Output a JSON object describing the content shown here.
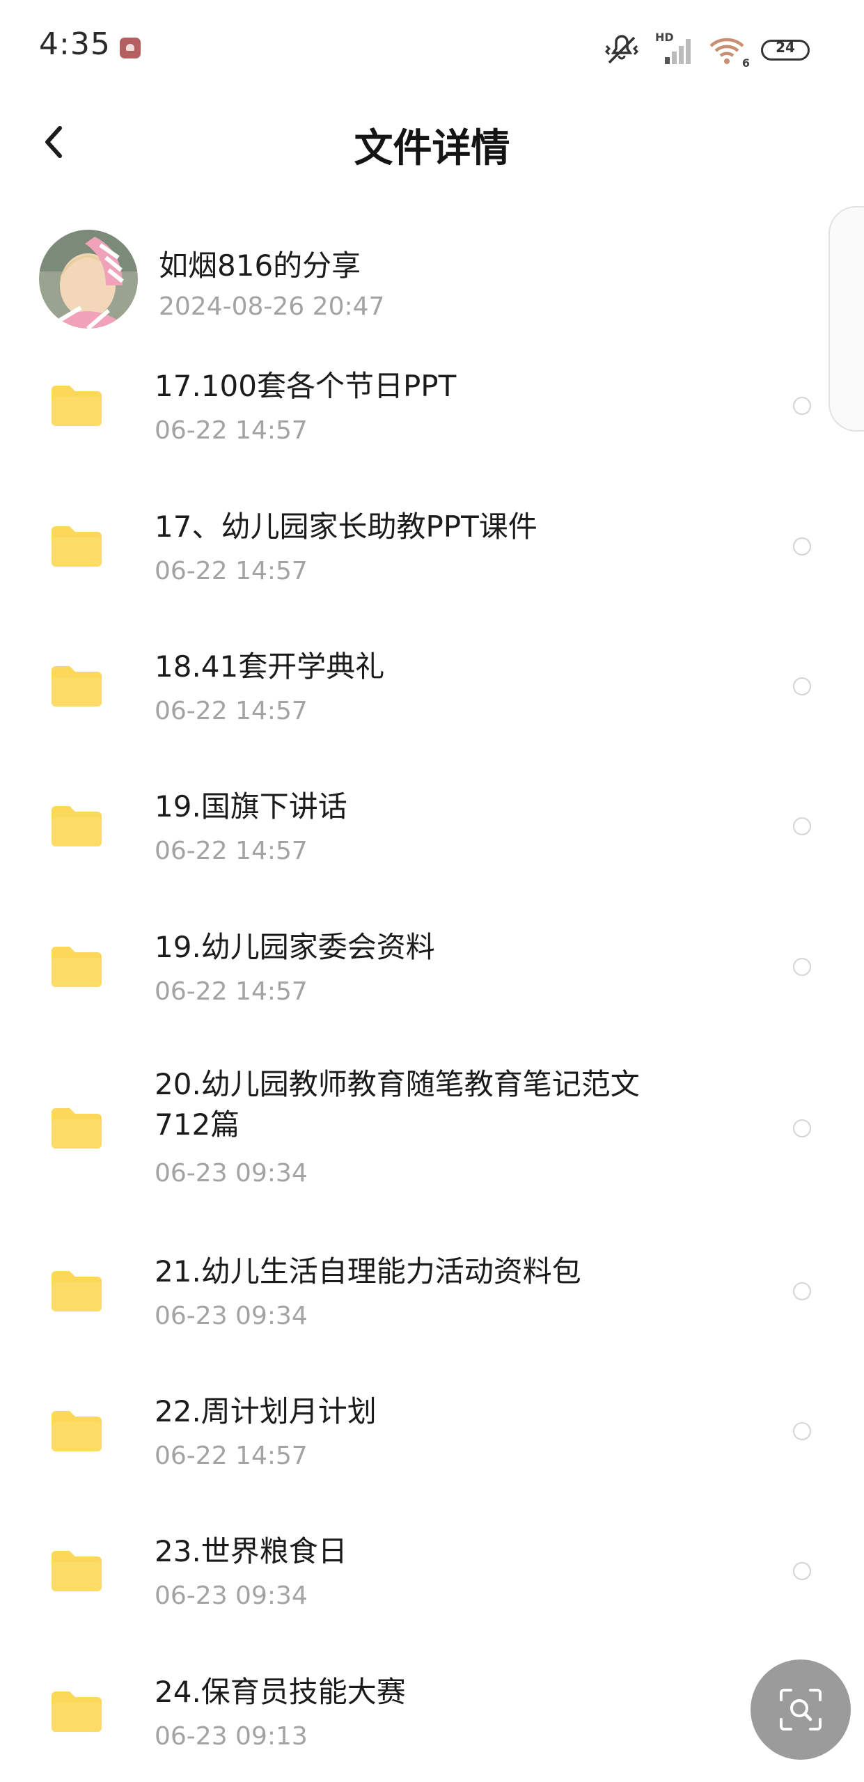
{
  "status_bar": {
    "time": "4:35",
    "network_label": "HD",
    "wifi_badge": "6",
    "battery": "24",
    "icons": [
      "app-notification-icon",
      "vibrate-off-icon",
      "cell-signal-icon",
      "wifi-icon",
      "battery-icon"
    ]
  },
  "header": {
    "back_icon": "chevron-left-icon",
    "title": "文件详情"
  },
  "owner": {
    "name": "如烟816的分享",
    "date": "2024-08-26  20:47"
  },
  "files": [
    {
      "name": "17.100套各个节日PPT",
      "date": "06-22  14:57"
    },
    {
      "name": "17、幼儿园家长助教PPT课件",
      "date": "06-22  14:57"
    },
    {
      "name": "18.41套开学典礼",
      "date": "06-22  14:57"
    },
    {
      "name": "19.国旗下讲话",
      "date": "06-22  14:57"
    },
    {
      "name": "19.幼儿园家委会资料",
      "date": "06-22  14:57"
    },
    {
      "name": "20.幼儿园教师教育随笔教育笔记范文712篇",
      "date": "06-23  09:34"
    },
    {
      "name": "21.幼儿生活自理能力活动资料包",
      "date": "06-23  09:34"
    },
    {
      "name": "22.周计划月计划",
      "date": "06-22  14:57"
    },
    {
      "name": "23.世界粮食日",
      "date": "06-23  09:34"
    },
    {
      "name": "24.保育员技能大赛",
      "date": "06-23  09:13"
    }
  ],
  "colors": {
    "folder": "#fbd75a",
    "text_primary": "#1b1b1b",
    "text_secondary": "#a3a3a3",
    "fab": "#9b9b9b"
  },
  "fab_icon": "scan-search-icon"
}
